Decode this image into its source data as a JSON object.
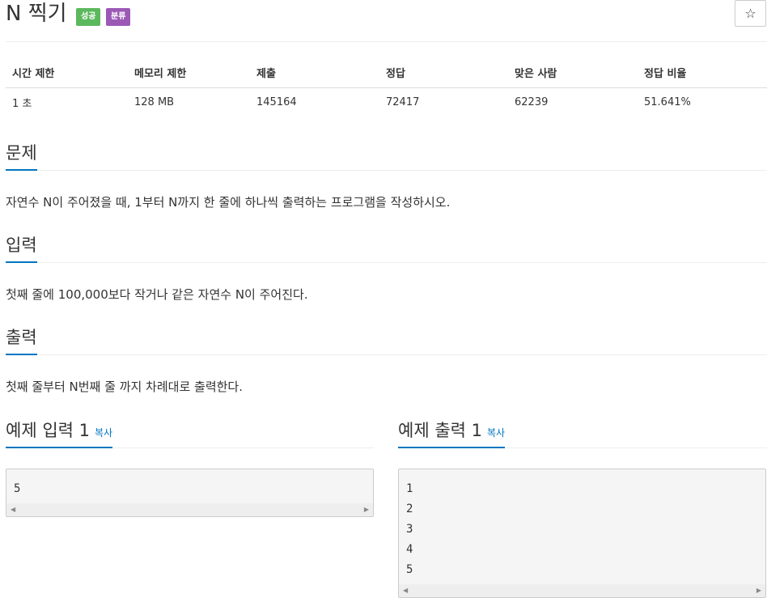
{
  "problem": {
    "title": "N 찍기",
    "badges": {
      "success": "성공",
      "category": "분류"
    },
    "star_icon": "☆"
  },
  "info": {
    "headers": [
      "시간 제한",
      "메모리 제한",
      "제출",
      "정답",
      "맞은 사람",
      "정답 비율"
    ],
    "values": [
      "1 초",
      "128 MB",
      "145164",
      "72417",
      "62239",
      "51.641%"
    ]
  },
  "sections": {
    "description": {
      "title": "문제",
      "text": "자연수 N이 주어졌을 때, 1부터 N까지 한 줄에 하나씩 출력하는 프로그램을 작성하시오."
    },
    "input": {
      "title": "입력",
      "text": "첫째 줄에 100,000보다 작거나 같은 자연수 N이 주어진다."
    },
    "output": {
      "title": "출력",
      "text": "첫째 줄부터 N번째 줄 까지 차례대로 출력한다."
    }
  },
  "samples": {
    "input": {
      "title": "예제 입력 1",
      "copy": "복사",
      "content": "5"
    },
    "output": {
      "title": "예제 출력 1",
      "copy": "복사",
      "content": "1\n2\n3\n4\n5"
    }
  },
  "icons": {
    "scroll_left": "◀",
    "scroll_right": "▶"
  },
  "colors": {
    "accent": "#0076c0",
    "badge_success": "#5cb85c",
    "badge_category": "#9b59b6"
  }
}
